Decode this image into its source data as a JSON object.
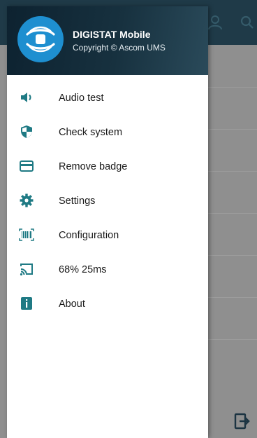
{
  "drawer": {
    "header": {
      "title": "DIGISTAT Mobile",
      "subtitle": "Copyright © Ascom UMS",
      "logo_icon": "hands-cube-logo"
    },
    "items": [
      {
        "label": "Audio test",
        "icon": "speaker-icon"
      },
      {
        "label": "Check system",
        "icon": "shield-icon"
      },
      {
        "label": "Remove badge",
        "icon": "credit-card-icon"
      },
      {
        "label": "Settings",
        "icon": "gear-icon"
      },
      {
        "label": "Configuration",
        "icon": "barcode-scan-icon"
      },
      {
        "label": "68% 25ms",
        "icon": "cast-icon"
      },
      {
        "label": "About",
        "icon": "info-icon"
      }
    ]
  },
  "background_app": {
    "toolbar_icons": [
      "user-group-icon",
      "search-icon"
    ],
    "bottom_action_icon": "exit-icon"
  },
  "colors": {
    "accent": "#1f7a84",
    "header_dark": "#0d2230",
    "logo_blue": "#1e8fd0",
    "scrim": "#8f8f8f"
  }
}
